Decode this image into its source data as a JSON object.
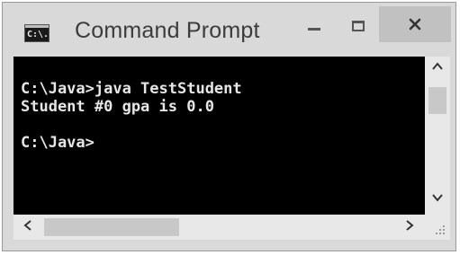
{
  "window": {
    "title": "Command Prompt",
    "icon_name": "console-icon",
    "icon_text": "C:\\."
  },
  "titlebar_buttons": {
    "minimize_icon": "minimize-icon",
    "maximize_icon": "maximize-icon",
    "close_glyph": "✕"
  },
  "console": {
    "lines": [
      "C:\\Java>java TestStudent",
      "Student #0 gpa is 0.0",
      "",
      "C:\\Java>"
    ],
    "colors": {
      "background": "#000000",
      "text": "#e6e6e6"
    }
  },
  "scrollbars": {
    "up_glyph": "^",
    "down_glyph": "v",
    "left_glyph": "<",
    "right_glyph": ">"
  }
}
